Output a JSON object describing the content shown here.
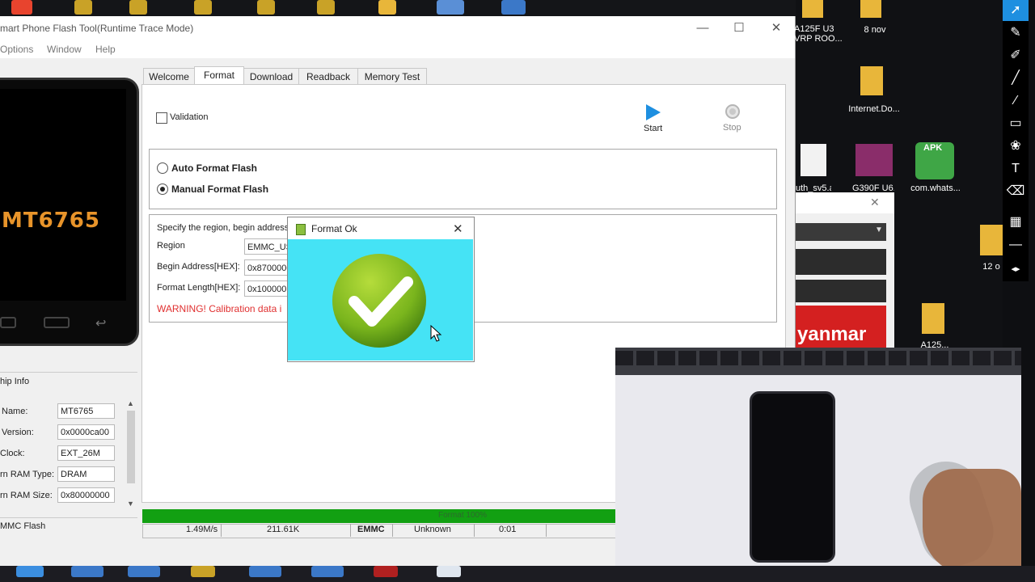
{
  "window": {
    "title": "mart Phone Flash Tool(Runtime Trace Mode)",
    "controls": {
      "minimize": "—",
      "maximize": "☐",
      "close": "✕"
    }
  },
  "menu": [
    "Options",
    "Window",
    "Help"
  ],
  "phone": {
    "chip_label": "MT6765"
  },
  "chip_info": {
    "header": "hip Info",
    "rows": [
      {
        "label": "Name:",
        "value": "MT6765"
      },
      {
        "label": "Version:",
        "value": "0x0000ca00"
      },
      {
        "label": "Clock:",
        "value": "EXT_26M"
      },
      {
        "label": "rn RAM Type:",
        "value": "DRAM"
      },
      {
        "label": "rn RAM Size:",
        "value": "0x80000000"
      }
    ],
    "footer": "MMC Flash"
  },
  "tabs": [
    "Welcome",
    "Format",
    "Download",
    "Readback",
    "Memory Test"
  ],
  "active_tab": "Format",
  "format": {
    "validation_label": "Validation",
    "start_label": "Start",
    "stop_label": "Stop",
    "auto_label": "Auto Format Flash",
    "manual_label": "Manual Format Flash",
    "manual_selected": true,
    "specify_text": "Specify the region, begin address",
    "region_label": "Region",
    "region_value": "EMMC_USE",
    "begin_label": "Begin Address[HEX]:",
    "begin_value": "0x8700000",
    "length_label": "Format Length[HEX]:",
    "length_value": "0x100000",
    "warning": "WARNING! Calibration data i"
  },
  "progress": {
    "text": "Format 100%",
    "fraction": 1.0
  },
  "status": {
    "speed": "1.49M/s",
    "size": "211.61K",
    "storage": "EMMC",
    "type": "Unknown",
    "time": "0:01"
  },
  "dialog": {
    "title": "Format Ok",
    "close": "✕"
  },
  "desktop": {
    "icons": [
      {
        "label": "A125F U3\nVRP ROO..."
      },
      {
        "label": "8 nov"
      },
      {
        "label": "Internet.Do..."
      },
      {
        "label": "uth_sv5.a..."
      },
      {
        "label": "G390F U6..."
      },
      {
        "label": "com.whats..."
      },
      {
        "label": "12 o"
      },
      {
        "label": "A125..."
      }
    ],
    "apk_badge": "APK",
    "partial_banner": "yanmar"
  },
  "colors": {
    "accent_blue": "#1e8fe0",
    "progress_green": "#12a012",
    "dialog_cyan": "#45e3f5",
    "warning_red": "#e03030",
    "check_green": "#7ab51d"
  }
}
